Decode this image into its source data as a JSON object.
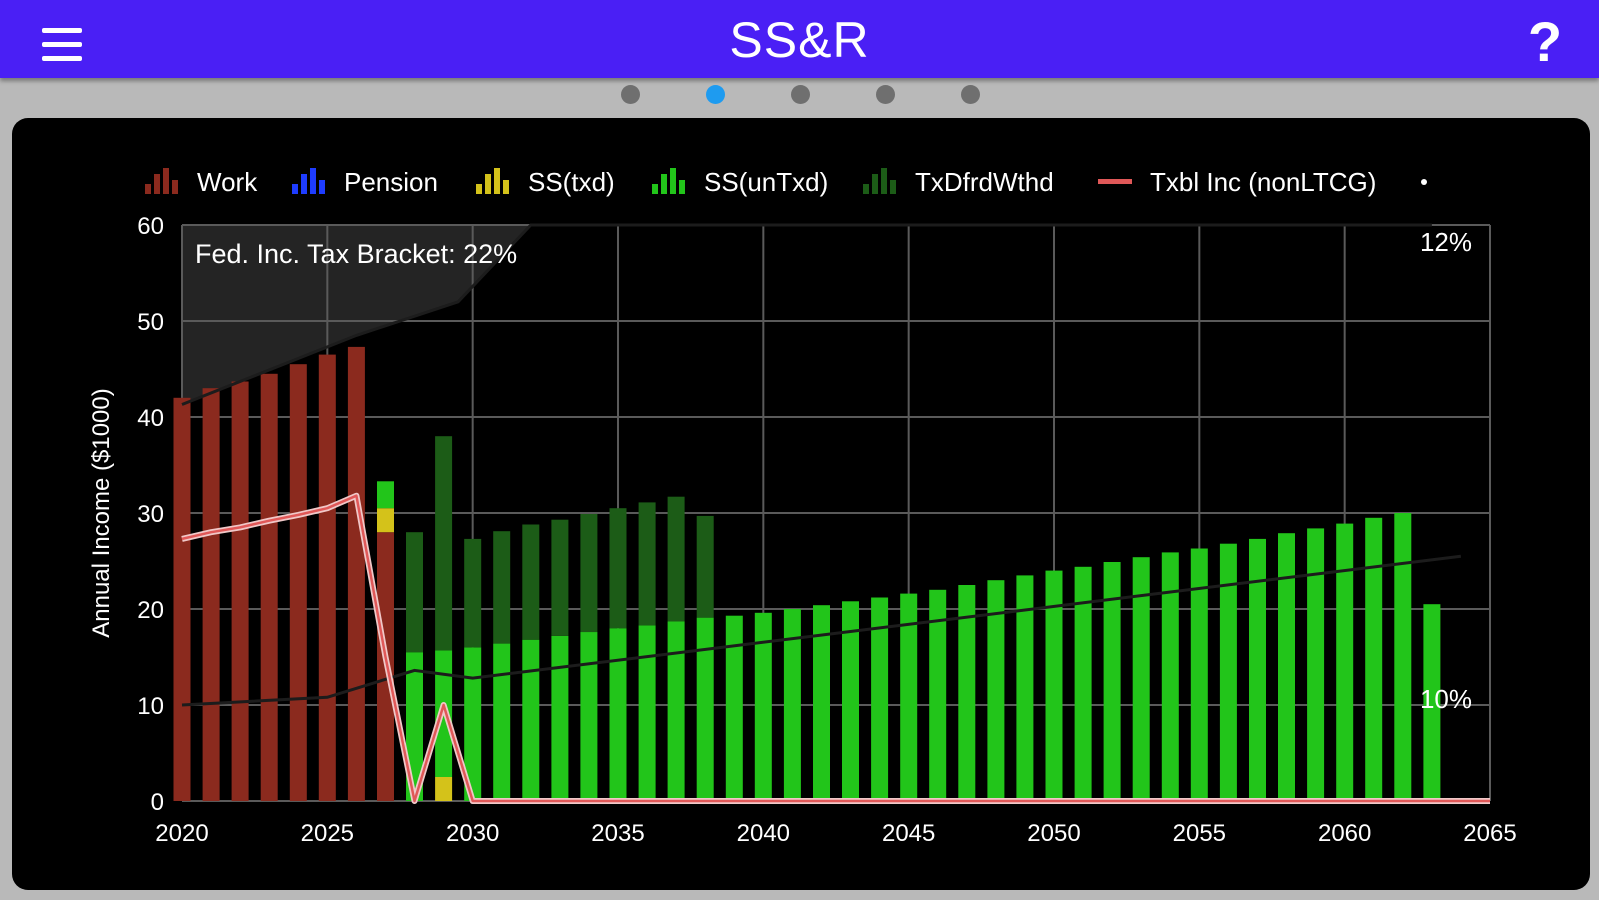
{
  "app": {
    "title": "SS&R",
    "help_label": "?"
  },
  "pager": {
    "count": 5,
    "active_index": 1
  },
  "colors": {
    "header": "#4a1ff5",
    "work": "#8b2a1e",
    "pension": "#1e3cff",
    "ss_txd": "#d4c21a",
    "ss_untxd": "#22c51a",
    "txdfrd": "#1c5c17",
    "txbl_inc": "#e05858",
    "dot_active": "#1e9bf0"
  },
  "chart_data": {
    "type": "bar",
    "stacked": true,
    "ylabel": "Annual Income ($1000)",
    "xlabel": "",
    "xlim": [
      2020,
      2065
    ],
    "ylim": [
      0,
      60
    ],
    "xticks": [
      "2020",
      "2025",
      "2030",
      "2035",
      "2040",
      "2045",
      "2050",
      "2055",
      "2060",
      "2065"
    ],
    "yticks": [
      "0",
      "10",
      "20",
      "30",
      "40",
      "50",
      "60"
    ],
    "grid": true,
    "legend_position": "top",
    "annotations": {
      "bracket_text": "Fed. Inc. Tax Bracket: 22%",
      "label_12": "12%",
      "label_10": "10%"
    },
    "legend": [
      {
        "name": "Work",
        "icon": "bars-icon"
      },
      {
        "name": "Pension",
        "icon": "bars-icon"
      },
      {
        "name": "SS(txd)",
        "icon": "bars-icon"
      },
      {
        "name": "SS(unTxd)",
        "icon": "bars-icon"
      },
      {
        "name": "TxDfrdWthd",
        "icon": "bars-icon"
      },
      {
        "name": "Txbl Inc (nonLTCG)",
        "icon": "line-icon"
      },
      {
        "name": "·",
        "icon": "dot-icon"
      }
    ],
    "categories": [
      2020,
      2021,
      2022,
      2023,
      2024,
      2025,
      2026,
      2027,
      2028,
      2029,
      2030,
      2031,
      2032,
      2033,
      2034,
      2035,
      2036,
      2037,
      2038,
      2039,
      2040,
      2041,
      2042,
      2043,
      2044,
      2045,
      2046,
      2047,
      2048,
      2049,
      2050,
      2051,
      2052,
      2053,
      2054,
      2055,
      2056,
      2057,
      2058,
      2059,
      2060,
      2061,
      2062,
      2063
    ],
    "series": [
      {
        "name": "Work",
        "values": [
          42,
          43,
          43.7,
          44.5,
          45.5,
          46.5,
          47.3,
          28,
          0,
          0,
          0,
          0,
          0,
          0,
          0,
          0,
          0,
          0,
          0,
          0,
          0,
          0,
          0,
          0,
          0,
          0,
          0,
          0,
          0,
          0,
          0,
          0,
          0,
          0,
          0,
          0,
          0,
          0,
          0,
          0,
          0,
          0,
          0,
          0
        ]
      },
      {
        "name": "Pension",
        "values": [
          0,
          0,
          0,
          0,
          0,
          0,
          0,
          0,
          0,
          0,
          0,
          0,
          0,
          0,
          0,
          0,
          0,
          0,
          0,
          0,
          0,
          0,
          0,
          0,
          0,
          0,
          0,
          0,
          0,
          0,
          0,
          0,
          0,
          0,
          0,
          0,
          0,
          0,
          0,
          0,
          0,
          0,
          0,
          0
        ]
      },
      {
        "name": "SS(txd)",
        "values": [
          0,
          0,
          0,
          0,
          0,
          0,
          0,
          2.5,
          0,
          2.5,
          0,
          0,
          0,
          0,
          0,
          0,
          0,
          0,
          0,
          0,
          0,
          0,
          0,
          0,
          0,
          0,
          0,
          0,
          0,
          0,
          0,
          0,
          0,
          0,
          0,
          0,
          0,
          0,
          0,
          0,
          0,
          0,
          0,
          0
        ]
      },
      {
        "name": "SS(unTxd)",
        "values": [
          0,
          0,
          0,
          0,
          0,
          0,
          0,
          2.8,
          15.5,
          13.2,
          16,
          16.4,
          16.8,
          17.2,
          17.6,
          18,
          18.3,
          18.7,
          19.1,
          19.3,
          19.6,
          20,
          20.4,
          20.8,
          21.2,
          21.6,
          22,
          22.5,
          23,
          23.5,
          24,
          24.4,
          24.9,
          25.4,
          25.9,
          26.3,
          26.8,
          27.3,
          27.9,
          28.4,
          28.9,
          29.5,
          30,
          20.5
        ]
      },
      {
        "name": "TxDfrdWthd",
        "values": [
          0,
          0,
          0,
          0,
          0,
          0,
          0,
          0,
          12.5,
          22.3,
          11.3,
          11.7,
          12,
          12.1,
          12.3,
          12.5,
          12.8,
          13,
          10.6,
          0,
          0,
          0,
          0,
          0,
          0,
          0,
          0,
          0,
          0,
          0,
          0,
          0,
          0,
          0,
          0,
          0,
          0,
          0,
          0,
          0,
          0,
          0,
          0,
          0
        ]
      },
      {
        "name": "Txbl Inc (nonLTCG)",
        "type": "line",
        "x": [
          2020,
          2021,
          2022,
          2023,
          2024,
          2025,
          2026,
          2027,
          2028,
          2029,
          2030,
          2065
        ],
        "values": [
          27.3,
          28,
          28.5,
          29.2,
          29.8,
          30.5,
          31.8,
          15,
          0,
          10,
          0,
          0
        ]
      }
    ],
    "bracket_boundaries": [
      {
        "name": "12%/22% boundary",
        "x": [
          2020,
          2026,
          2029.5,
          2032,
          2063
        ],
        "values": [
          41.3,
          48.5,
          52,
          60,
          60
        ]
      },
      {
        "name": "10%/12% boundary",
        "x": [
          2020,
          2025,
          2028,
          2030,
          2064
        ],
        "values": [
          10,
          10.8,
          13.6,
          12.8,
          25.5
        ]
      }
    ]
  }
}
